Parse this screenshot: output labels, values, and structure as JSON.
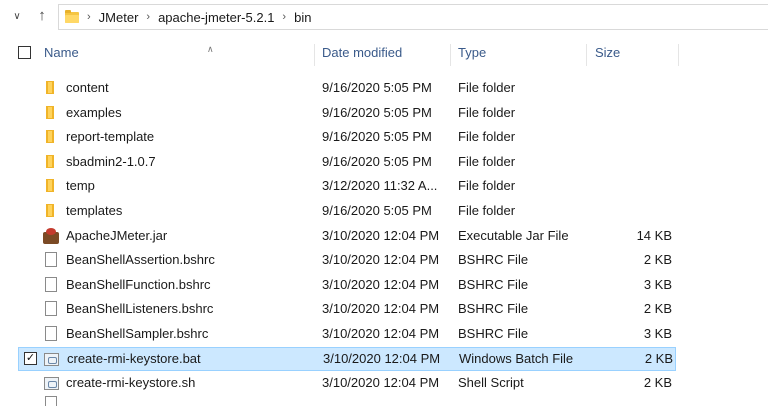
{
  "address": {
    "crumbs": [
      "JMeter",
      "apache-jmeter-5.2.1",
      "bin"
    ]
  },
  "columns": {
    "name": "Name",
    "date": "Date modified",
    "type": "Type",
    "size": "Size"
  },
  "rows": [
    {
      "name": "content",
      "date": "9/16/2020 5:05 PM",
      "type": "File folder",
      "size": "",
      "icon": "folder-icon",
      "selected": false
    },
    {
      "name": "examples",
      "date": "9/16/2020 5:05 PM",
      "type": "File folder",
      "size": "",
      "icon": "folder-icon",
      "selected": false
    },
    {
      "name": "report-template",
      "date": "9/16/2020 5:05 PM",
      "type": "File folder",
      "size": "",
      "icon": "folder-icon",
      "selected": false
    },
    {
      "name": "sbadmin2-1.0.7",
      "date": "9/16/2020 5:05 PM",
      "type": "File folder",
      "size": "",
      "icon": "folder-icon",
      "selected": false
    },
    {
      "name": "temp",
      "date": "3/12/2020 11:32 A...",
      "type": "File folder",
      "size": "",
      "icon": "folder-icon",
      "selected": false
    },
    {
      "name": "templates",
      "date": "9/16/2020 5:05 PM",
      "type": "File folder",
      "size": "",
      "icon": "folder-icon",
      "selected": false
    },
    {
      "name": "ApacheJMeter.jar",
      "date": "3/10/2020 12:04 PM",
      "type": "Executable Jar File",
      "size": "14 KB",
      "icon": "java-jar-icon",
      "selected": false
    },
    {
      "name": "BeanShellAssertion.bshrc",
      "date": "3/10/2020 12:04 PM",
      "type": "BSHRC File",
      "size": "2 KB",
      "icon": "file-icon",
      "selected": false
    },
    {
      "name": "BeanShellFunction.bshrc",
      "date": "3/10/2020 12:04 PM",
      "type": "BSHRC File",
      "size": "3 KB",
      "icon": "file-icon",
      "selected": false
    },
    {
      "name": "BeanShellListeners.bshrc",
      "date": "3/10/2020 12:04 PM",
      "type": "BSHRC File",
      "size": "2 KB",
      "icon": "file-icon",
      "selected": false
    },
    {
      "name": "BeanShellSampler.bshrc",
      "date": "3/10/2020 12:04 PM",
      "type": "BSHRC File",
      "size": "3 KB",
      "icon": "file-icon",
      "selected": false
    },
    {
      "name": "create-rmi-keystore.bat",
      "date": "3/10/2020 12:04 PM",
      "type": "Windows Batch File",
      "size": "2 KB",
      "icon": "batch-file-icon",
      "selected": true
    },
    {
      "name": "create-rmi-keystore.sh",
      "date": "3/10/2020 12:04 PM",
      "type": "Shell Script",
      "size": "2 KB",
      "icon": "shell-script-icon",
      "selected": false
    }
  ]
}
